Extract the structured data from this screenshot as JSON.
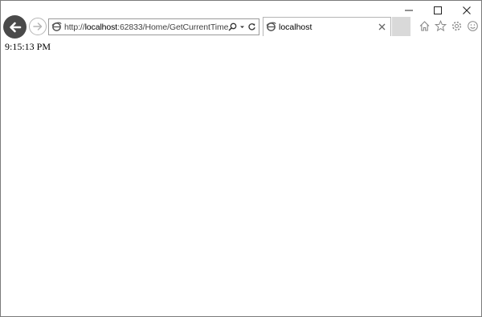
{
  "browser": {
    "address_url_prefix": "http://",
    "address_url_host": "localhost",
    "address_url_rest": ":62833/Home/GetCurrentTime",
    "tab_title": "localhost",
    "icons": [
      "back-arrow-icon",
      "forward-arrow-icon",
      "ie-page-icon",
      "search-icon",
      "dropdown-icon",
      "refresh-icon",
      "close-icon",
      "home-icon",
      "favorites-star-icon",
      "settings-gear-icon",
      "smiley-feedback-icon",
      "minimize-icon",
      "maximize-icon",
      "window-close-icon"
    ]
  },
  "page": {
    "time_text": "9:15:13 PM"
  }
}
